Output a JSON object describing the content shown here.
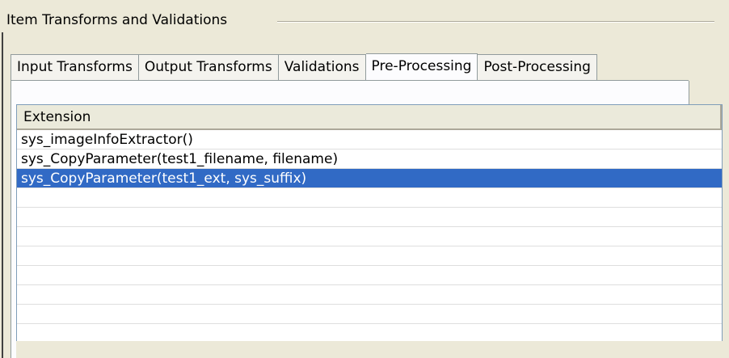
{
  "group": {
    "title": "Item Transforms and Validations"
  },
  "tabs": [
    {
      "label": "Input Transforms",
      "active": false
    },
    {
      "label": "Output Transforms",
      "active": false
    },
    {
      "label": "Validations",
      "active": false
    },
    {
      "label": "Pre-Processing",
      "active": true
    },
    {
      "label": "Post-Processing",
      "active": false
    }
  ],
  "table": {
    "columns": [
      "Extension"
    ],
    "rows": [
      {
        "extension": "sys_imageInfoExtractor()",
        "selected": false
      },
      {
        "extension": "sys_CopyParameter(test1_filename, filename)",
        "selected": false
      },
      {
        "extension": "sys_CopyParameter(test1_ext, sys_suffix)",
        "selected": true
      },
      {
        "extension": "",
        "selected": false
      },
      {
        "extension": "",
        "selected": false
      },
      {
        "extension": "",
        "selected": false
      },
      {
        "extension": "",
        "selected": false
      },
      {
        "extension": "",
        "selected": false
      },
      {
        "extension": "",
        "selected": false
      },
      {
        "extension": "",
        "selected": false
      }
    ]
  },
  "colors": {
    "selection": "#316ac5",
    "panel": "#ece9d8",
    "tab_border": "#919b9c"
  }
}
